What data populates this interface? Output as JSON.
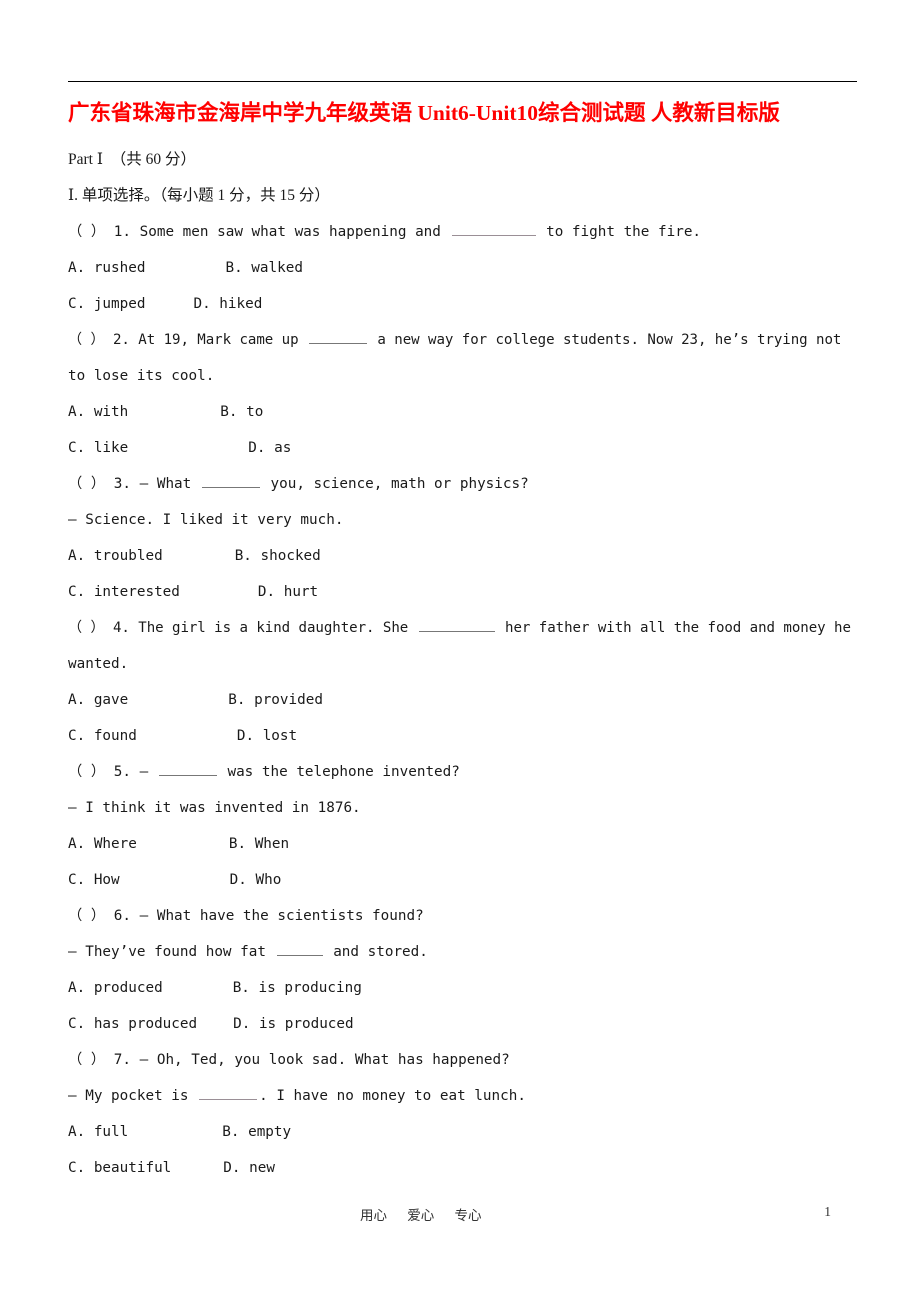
{
  "document": {
    "title": "广东省珠海市金海岸中学九年级英语 Unit6-Unit10综合测试题 人教新目标版",
    "title_color": "#FF0000",
    "part_heading": "Part Ⅰ  （共 60 分）",
    "section_heading": "Ⅰ. 单项选择。（每小题 1 分，共 15 分）"
  },
  "questions": [
    {
      "stem": "（ ） 1. Some men saw what was happening and ",
      "stem_tail": " to fight the fire.",
      "stem2": "",
      "options": {
        "a": "A. rushed",
        "b": "B. walked",
        "c": "C. jumped",
        "d": "D. hiked"
      }
    },
    {
      "stem": "（ ） 2. At 19, Mark came up ",
      "stem_tail": " a new way for college students. Now 23, he’s trying not",
      "stem2": "to lose its cool.",
      "options": {
        "a": "A. with",
        "b": "B. to",
        "c": "C. like",
        "d": "D. as"
      }
    },
    {
      "stem": "（ ） 3. — What ",
      "stem_tail": " you, science, math or physics?",
      "stem2": "— Science. I liked it very much.",
      "options": {
        "a": "A. troubled",
        "b": "B. shocked",
        "c": "C. interested",
        "d": "D. hurt"
      }
    },
    {
      "stem": "（ ） 4. The girl is a kind daughter. She ",
      "stem_tail": " her father with all the food and money he",
      "stem2": "wanted.",
      "options": {
        "a": "A. gave",
        "b": "B. provided",
        "c": "C. found",
        "d": "D. lost"
      }
    },
    {
      "stem": "（ ） 5. — ",
      "stem_tail": " was the telephone invented?",
      "stem2": "— I think it was invented in 1876.",
      "options": {
        "a": "A. Where",
        "b": "B. When",
        "c": "C. How",
        "d": "D. Who"
      }
    },
    {
      "stem": "（ ） 6. — What have the scientists found?",
      "stem_tail": "",
      "stem2_pre": "— They’ve found how fat ",
      "stem2_post": " and stored.",
      "options": {
        "a": "A. produced",
        "b": "B. is producing",
        "c": "C. has produced",
        "d": "D. is produced"
      }
    },
    {
      "stem": "（ ） 7. — Oh, Ted, you look sad. What has happened?",
      "stem_tail": "",
      "stem2_pre": "— My pocket is ",
      "stem2_post": ". I have no money to eat lunch.",
      "options": {
        "a": "A. full",
        "b": "B. empty",
        "c": "C. beautiful",
        "d": "D. new"
      }
    }
  ],
  "footer": {
    "motto": "用心      爱心      专心",
    "page_number": "1"
  }
}
